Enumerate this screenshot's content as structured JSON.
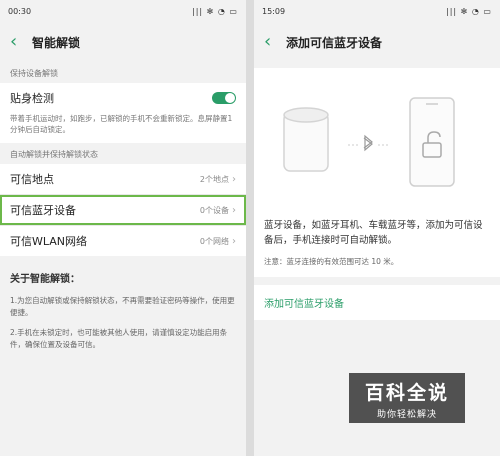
{
  "left": {
    "status": {
      "time": "00:30",
      "icons": "|||  ✻ ◔ ▭"
    },
    "title": "智能解锁",
    "section1": "保持设备解锁",
    "body_detect": {
      "label": "贴身检测",
      "enabled": true,
      "desc": "带着手机运动时，如跑步，已解锁的手机不会重新锁定。息屏静置1分钟后自动锁定。"
    },
    "section2": "自动解锁并保持解锁状态",
    "items": [
      {
        "label": "可信地点",
        "meta": "2个地点"
      },
      {
        "label": "可信蓝牙设备",
        "meta": "0个设备"
      },
      {
        "label": "可信WLAN网络",
        "meta": "0个网络"
      }
    ],
    "about": {
      "title": "关于智能解锁：",
      "p1": "1.为您自动解锁或保持解锁状态，不再需要验证密码等操作，使用更便捷。",
      "p2": "2.手机在未锁定时，也可能被其他人使用，请谨慎设定功能启用条件，确保位置及设备可信。"
    }
  },
  "right": {
    "status": {
      "time": "15:09",
      "icons": "|||  ✻ ◔ ▭"
    },
    "title": "添加可信蓝牙设备",
    "illustration": {
      "speaker": "speaker-icon",
      "bluetooth": "bluetooth-icon",
      "phone": "phone-icon",
      "lock": "unlock-icon"
    },
    "main_text": "蓝牙设备，如蓝牙耳机、车载蓝牙等，添加为可信设备后，手机连接时可自动解锁。",
    "note": "注意：蓝牙连接的有效范围可达 10 米。",
    "add_link": "添加可信蓝牙设备"
  },
  "watermark": {
    "title": "百科全说",
    "subtitle": "助你轻松解决"
  },
  "colors": {
    "accent": "#2a9d68",
    "highlight": "#6cb84a"
  }
}
